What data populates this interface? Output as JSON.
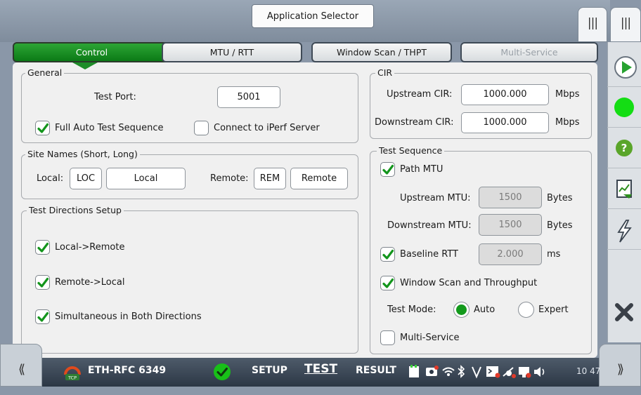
{
  "header": {
    "app_selector_label": "Application Selector",
    "pane_button_label": "|||",
    "pane_button_label_2": "|||"
  },
  "tabs": [
    {
      "label": "Control",
      "state": "active"
    },
    {
      "label": "MTU / RTT",
      "state": "normal"
    },
    {
      "label": "Window Scan / THPT",
      "state": "normal"
    },
    {
      "label": "Multi-Service",
      "state": "disabled"
    }
  ],
  "general": {
    "title": "General",
    "test_port_label": "Test Port:",
    "test_port_value": "5001",
    "full_auto_label": "Full Auto Test Sequence",
    "full_auto_checked": true,
    "iperf_label": "Connect to iPerf Server",
    "iperf_checked": false
  },
  "site_names": {
    "title": "Site Names (Short, Long)",
    "local_label": "Local:",
    "local_short": "LOC",
    "local_long": "Local",
    "remote_label": "Remote:",
    "remote_short": "REM",
    "remote_long": "Remote"
  },
  "directions": {
    "title": "Test Directions Setup",
    "local_to_remote": "Local->Remote",
    "remote_to_local": "Remote->Local",
    "simultaneous": "Simultaneous in Both Directions"
  },
  "cir": {
    "title": "CIR",
    "upstream_label": "Upstream CIR:",
    "upstream_value": "1000.000",
    "downstream_label": "Downstream CIR:",
    "downstream_value": "1000.000",
    "unit": "Mbps"
  },
  "test_sequence": {
    "title": "Test Sequence",
    "path_mtu_label": "Path MTU",
    "upstream_mtu_label": "Upstream MTU:",
    "upstream_mtu_value": "1500",
    "downstream_mtu_label": "Downstream MTU:",
    "downstream_mtu_value": "1500",
    "mtu_unit": "Bytes",
    "baseline_rtt_label": "Baseline RTT",
    "baseline_rtt_value": "2.000",
    "rtt_unit": "ms",
    "window_scan_label": "Window Scan and Throughput",
    "test_mode_label": "Test Mode:",
    "auto_label": "Auto",
    "expert_label": "Expert",
    "test_mode_selected": "Auto",
    "multi_service_label": "Multi-Service",
    "multi_service_checked": false
  },
  "status_bar": {
    "left_nav": "⟪",
    "right_nav": "⟫",
    "test_name": "ETH-RFC 6349",
    "setup": "SETUP",
    "test": "TEST",
    "result": "RESULT",
    "time": "10 47",
    "tcp_badge": "TCP"
  },
  "colors": {
    "accent_green": "#139a1c",
    "tab_active": "#1e8d29",
    "close_icon": "#3a4048",
    "help_icon": "#5aa52a"
  }
}
